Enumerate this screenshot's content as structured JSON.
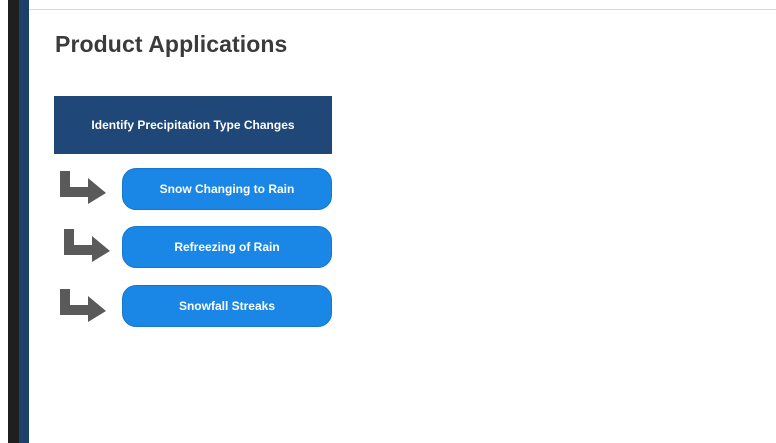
{
  "slide": {
    "title": "Product Applications",
    "header_box": "Identify Precipitation Type Changes",
    "items": [
      {
        "label": "Snow Changing to Rain"
      },
      {
        "label": "Refreezing of Rain"
      },
      {
        "label": "Snowfall Streaks"
      }
    ]
  },
  "colors": {
    "header_bg": "#1f4777",
    "pill_bg": "#1a86e6",
    "arrow": "#5a5a5a",
    "left_bar_dark": "#1f1f1f",
    "left_bar_blue": "#1d3f6c"
  },
  "icons": [
    "elbow-arrow-icon"
  ]
}
